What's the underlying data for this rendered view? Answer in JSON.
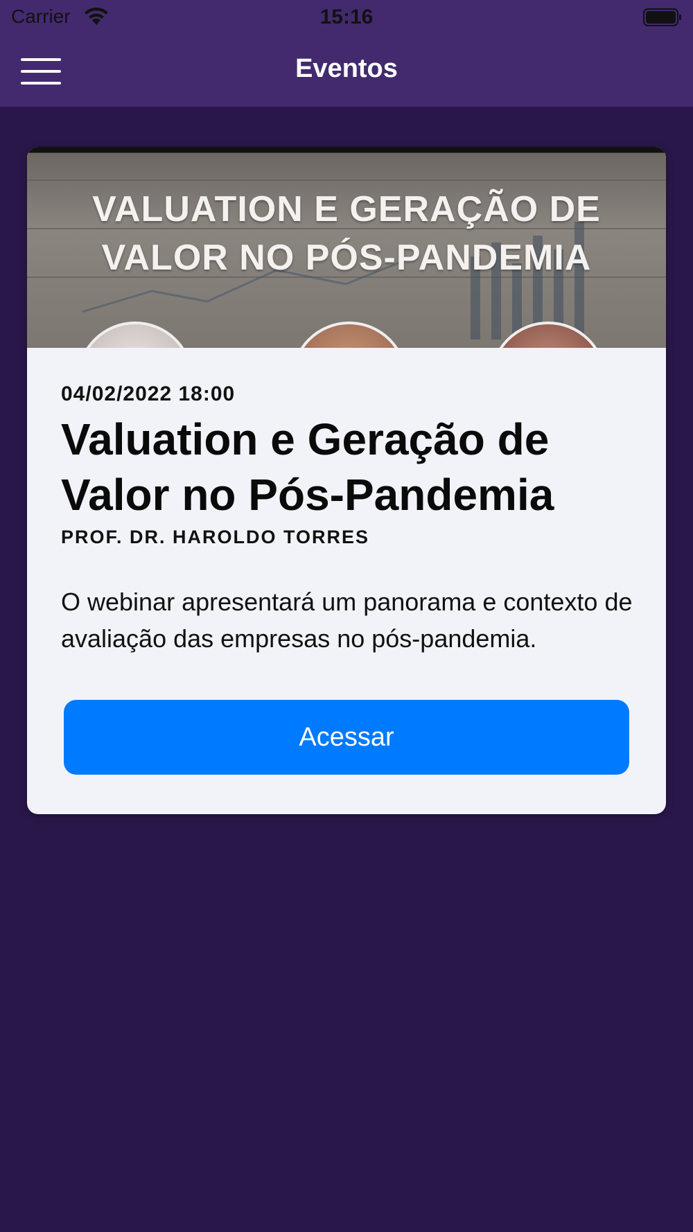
{
  "status_bar": {
    "carrier": "Carrier",
    "time": "15:16"
  },
  "nav": {
    "title": "Eventos"
  },
  "event": {
    "banner_text": "VALUATION E GERAÇÃO DE VALOR NO PÓS-PANDEMIA",
    "date": "04/02/2022 18:00",
    "title": "Valuation e Geração de Valor no Pós-Pandemia",
    "speaker": "PROF. DR. HAROLDO TORRES",
    "description": "O webinar apresentará um panorama e contexto de avaliação das empresas no pós-pandemia.",
    "button_label": "Acessar"
  },
  "colors": {
    "background": "#29174a",
    "nav": "#432a6e",
    "card": "#f2f3f8",
    "button": "#007aff"
  }
}
